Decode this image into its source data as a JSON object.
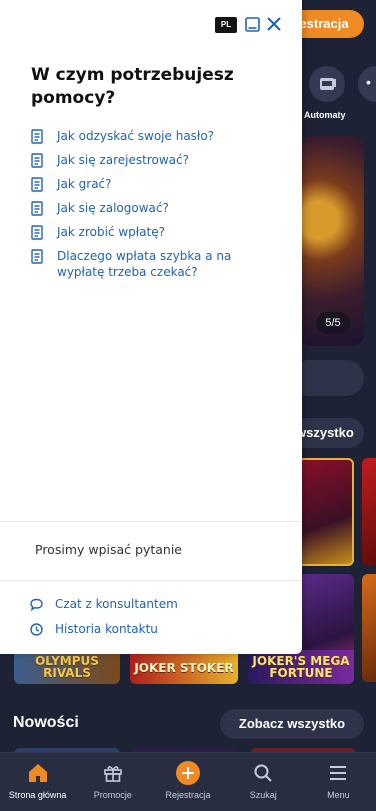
{
  "header": {
    "language": "PL",
    "register_label": "estracja"
  },
  "help_panel": {
    "title": "W czym potrzebujesz pomocy?",
    "faq": [
      "Jak odzyskać swoje hasło?",
      "Jak się zarejestrować?",
      "Jak grać?",
      "Jak się zalogować?",
      "Jak zrobić wpłatę?",
      "Dlaczego wpłata szybka a na wypłatę trzeba czekać?"
    ],
    "input_prompt": "Prosimy wpisać pytanie",
    "actions": {
      "chat": "Czat z konsultantem",
      "history": "Historia kontaktu"
    }
  },
  "background": {
    "category_label": "Automaty",
    "banner_counter": "5/5",
    "see_all_partial": "wszystko",
    "games": [
      "OLYMPUS RIVALS",
      "JOKER STOKER",
      "JOKER'S MEGA FORTUNE"
    ],
    "new_section_title": "Nowości",
    "see_all_label": "Zobacz wszystko"
  },
  "bottom_nav": [
    {
      "label": "Strona główna",
      "icon": "home-icon"
    },
    {
      "label": "Promocje",
      "icon": "gift-icon"
    },
    {
      "label": "Rejestracja",
      "icon": "plus-icon"
    },
    {
      "label": "Szukaj",
      "icon": "search-icon"
    },
    {
      "label": "Menu",
      "icon": "menu-icon"
    }
  ],
  "colors": {
    "accent": "#f08a24",
    "link": "#1f63b5",
    "background": "#1e2235",
    "nav": "#292d42"
  }
}
